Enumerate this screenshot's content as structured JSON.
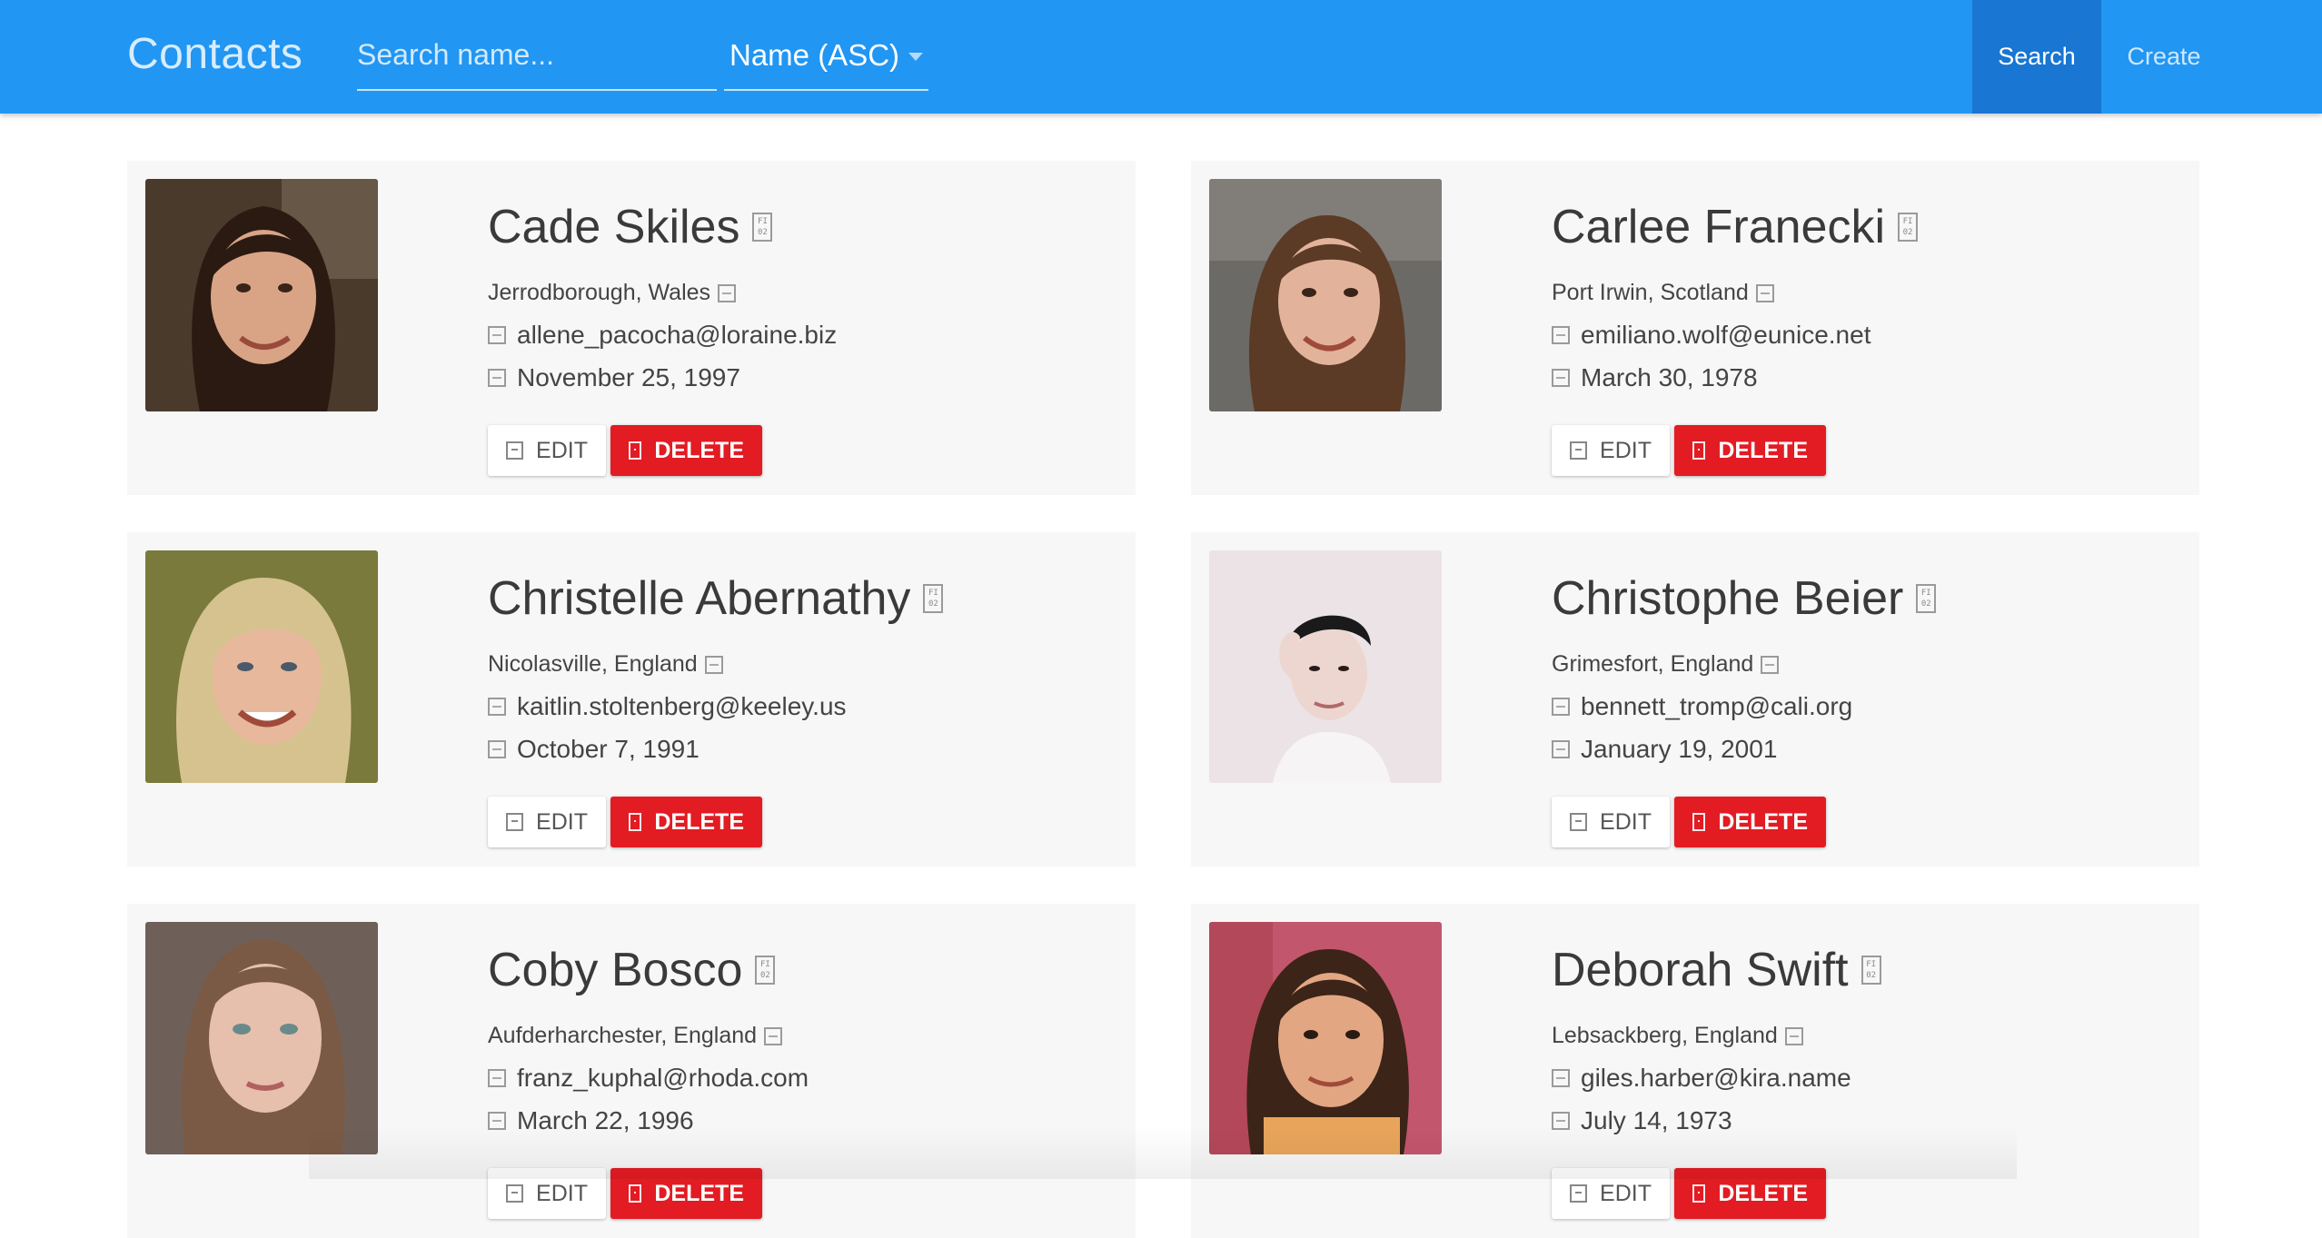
{
  "header": {
    "brand": "Contacts",
    "search_placeholder": "Search name...",
    "search_value": "",
    "sort_value": "Name (ASC)",
    "search_button": "Search",
    "create_button": "Create",
    "colors": {
      "bar": "#2196f3",
      "search_button_bg": "#1976d2"
    }
  },
  "contacts": [
    {
      "name": "Cade Skiles",
      "location": "Jerrodborough, Wales",
      "email": "allene_pacocha@loraine.biz",
      "dob": "November 25, 1997",
      "photo_colors": {
        "bg": "#4a3a2c",
        "hair": "#2a1a12",
        "skin": "#d9a486"
      }
    },
    {
      "name": "Carlee Franecki",
      "location": "Port Irwin, Scotland",
      "email": "emiliano.wolf@eunice.net",
      "dob": "March 30, 1978",
      "photo_colors": {
        "bg": "#6b6a66",
        "hair": "#5b3a26",
        "skin": "#e2b39a"
      }
    },
    {
      "name": "Christelle Abernathy",
      "location": "Nicolasville, England",
      "email": "kaitlin.stoltenberg@keeley.us",
      "dob": "October 7, 1991",
      "photo_colors": {
        "bg": "#7a7a3c",
        "hair": "#d6c28f",
        "skin": "#e7b89b"
      }
    },
    {
      "name": "Christophe Beier",
      "location": "Grimesfort, England",
      "email": "bennett_tromp@cali.org",
      "dob": "January 19, 2001",
      "photo_colors": {
        "bg": "#ece3e6",
        "hair": "#1a1a1a",
        "skin": "#edd6cf"
      }
    },
    {
      "name": "Coby Bosco",
      "location": "Aufderharchester, England",
      "email": "franz_kuphal@rhoda.com",
      "dob": "March 22, 1996",
      "photo_colors": {
        "bg": "#6e6058",
        "hair": "#7a5a44",
        "skin": "#e6c0ad"
      }
    },
    {
      "name": "Deborah Swift",
      "location": "Lebsackberg, England",
      "email": "giles.harber@kira.name",
      "dob": "July 14, 1973",
      "photo_colors": {
        "bg": "#c2566d",
        "hair": "#3c2418",
        "skin": "#e2a682"
      }
    }
  ],
  "actions": {
    "edit": "EDIT",
    "delete": "DELETE"
  }
}
